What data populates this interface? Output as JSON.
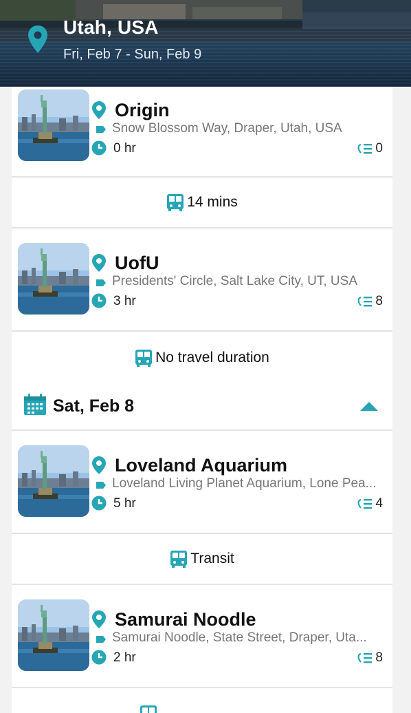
{
  "header": {
    "title": "Utah, USA",
    "dates": "Fri, Feb 7 - Sun, Feb 9"
  },
  "accent": "#26a6b5",
  "stops_day1": [
    {
      "name": "Origin",
      "address": "Snow Blossom Way, Draper, Utah, USA",
      "duration": "0 hr",
      "count": "0"
    },
    {
      "name": "UofU",
      "address": "Presidents' Circle, Salt Lake City, UT, USA",
      "duration": "3 hr",
      "count": "8"
    }
  ],
  "travel_1": "14 mins",
  "travel_2": "No travel duration",
  "day2": {
    "label": "Sat, Feb 8"
  },
  "stops_day2": [
    {
      "name": "Loveland Aquarium",
      "address": "Loveland Living Planet Aquarium, Lone Pea...",
      "duration": "5 hr",
      "count": "4"
    },
    {
      "name": "Samurai Noodle",
      "address": "Samurai Noodle, State Street, Draper, Uta...",
      "duration": "2 hr",
      "count": "8"
    }
  ],
  "travel_3": "Transit",
  "icons": [
    "location-pin-icon",
    "tag-icon",
    "clock-icon",
    "list-count-icon",
    "bus-icon",
    "calendar-icon",
    "caret-up-icon"
  ]
}
